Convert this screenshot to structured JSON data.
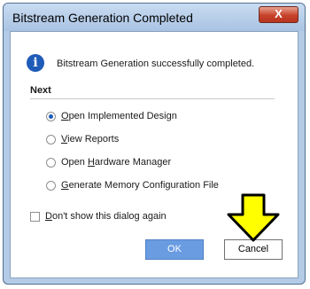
{
  "window": {
    "title": "Bitstream Generation Completed",
    "close_glyph": "X"
  },
  "message": {
    "icon": "info-icon",
    "text": "Bitstream Generation successfully completed."
  },
  "next": {
    "label": "Next",
    "options": [
      {
        "mnemonic": "O",
        "rest": "pen Implemented Design",
        "checked": true
      },
      {
        "mnemonic": "V",
        "rest": "iew Reports",
        "checked": false
      },
      {
        "pre": "Open ",
        "mnemonic": "H",
        "rest": "ardware Manager",
        "checked": false
      },
      {
        "mnemonic": "G",
        "rest": "enerate Memory Configuration File",
        "checked": false
      }
    ]
  },
  "dont_show": {
    "mnemonic": "D",
    "rest": "on't show this dialog again",
    "checked": false
  },
  "buttons": {
    "ok": "OK",
    "cancel": "Cancel"
  },
  "colors": {
    "accent": "#1f5bb8",
    "ok_button": "#6a9ce2",
    "arrow": "#ffff00"
  }
}
